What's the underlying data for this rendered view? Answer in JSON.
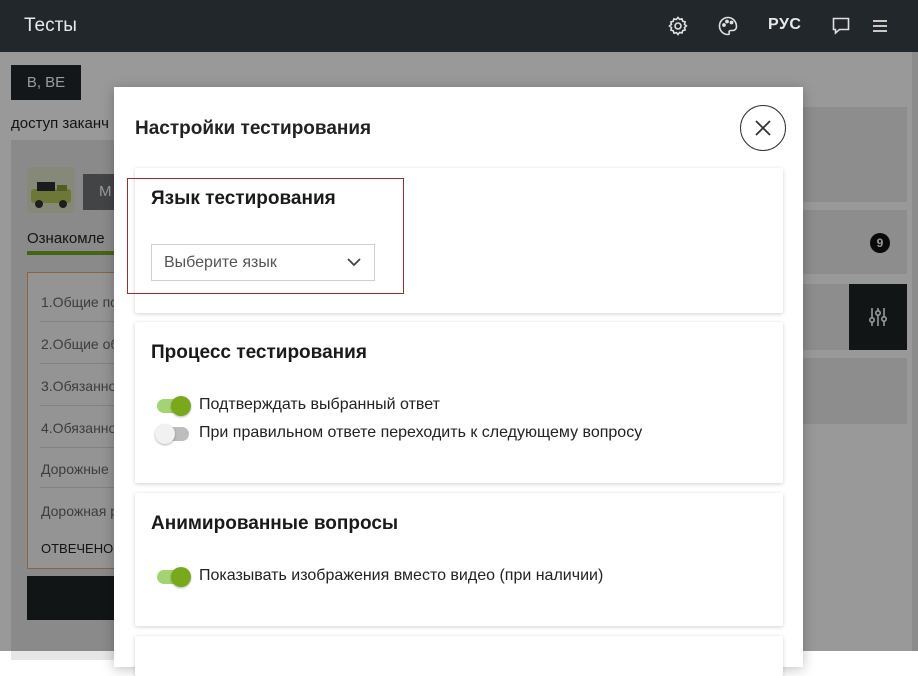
{
  "header": {
    "app_title": "Тесты",
    "language_button": "РУС",
    "icons": [
      "gear-icon",
      "palette-icon",
      "chat-icon",
      "menu-icon"
    ]
  },
  "background": {
    "category_button": "B, BE",
    "access_text": "доступ заканч",
    "mode_button": "М",
    "tab_label": "Ознакомле",
    "question_list": [
      "1.Общие по",
      "2.Общие об",
      "3.Обязанно",
      "4.Обязанно",
      "Дорожные",
      "Дорожная р"
    ],
    "answered_label": "ОТВЕЧЕНО",
    "badge_count": "9"
  },
  "modal": {
    "title": "Настройки тестирования",
    "language_section": {
      "title": "Язык тестирования",
      "select_placeholder": "Выберите язык"
    },
    "process_section": {
      "title": "Процесс тестирования",
      "toggles": [
        {
          "label": "Подтверждать выбранный ответ",
          "checked": true
        },
        {
          "label": "При правильном ответе переходить к следующему вопросу",
          "checked": false
        }
      ]
    },
    "animated_section": {
      "title": "Анимированные вопросы",
      "toggles": [
        {
          "label": "Показывать изображения вместо видео (при наличии)",
          "checked": true
        }
      ]
    }
  },
  "colors": {
    "topbar": "#22272b",
    "accent_green": "#7aa81c",
    "highlight_border": "#9b2c2c"
  }
}
